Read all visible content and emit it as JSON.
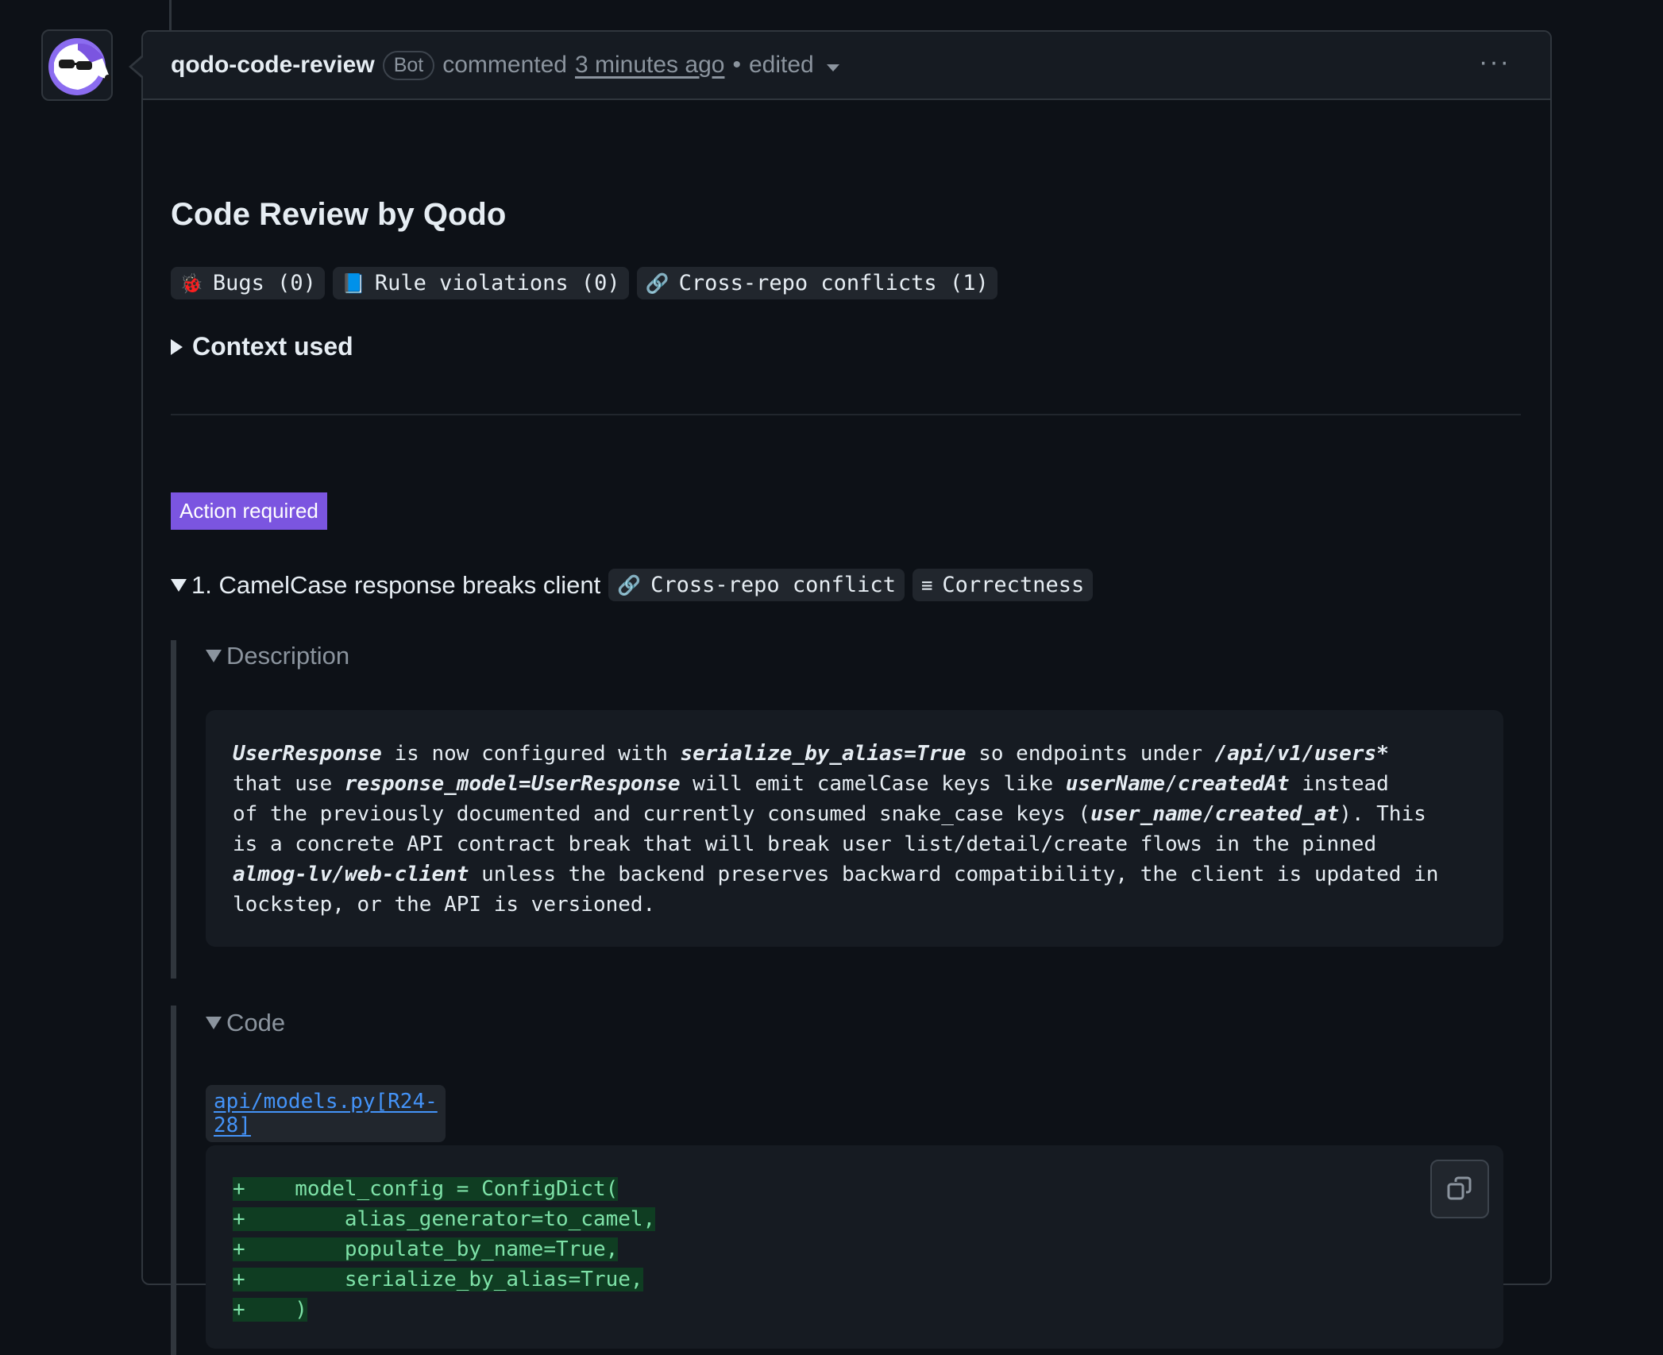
{
  "comment": {
    "author": "qodo-code-review",
    "badge": "Bot",
    "action": "commented",
    "time": "3 minutes ago",
    "separator": "•",
    "edited": "edited",
    "menu": "···"
  },
  "review": {
    "title": "Code Review by Qodo",
    "chips": [
      {
        "icon": "ladybug-icon",
        "glyph": "🐞",
        "label": "Bugs (0)"
      },
      {
        "icon": "book-icon",
        "glyph": "📘",
        "label": "Rule violations (0)"
      },
      {
        "icon": "link-icon",
        "glyph": "🔗",
        "label": "Cross-repo conflicts (1)"
      }
    ],
    "context_label": "Context used",
    "action_badge": "Action required",
    "issue": {
      "title": "1. CamelCase response breaks client",
      "tags": [
        {
          "icon": "link-icon",
          "glyph": "🔗",
          "label": "Cross-repo conflict"
        },
        {
          "icon": "list-icon",
          "glyph": "≡",
          "label": "Correctness"
        }
      ],
      "description_heading": "Description",
      "description": {
        "p1": "UserResponse",
        "p2": " is now configured with ",
        "p3": "serialize_by_alias=True",
        "p4": " so endpoints under ",
        "p5": "/api/v1/users*",
        "p6": "that use ",
        "p7": "response_model=UserResponse",
        "p8": " will emit camelCase keys like ",
        "p9": "userName",
        "p10": "/",
        "p11": "createdAt",
        "p12": " instead",
        "p13": "of the previously documented and currently consumed snake_case keys (",
        "p14": "user_name",
        "p15": "/",
        "p16": "created_at",
        "p17": "). This",
        "p18": "is a concrete API contract break that will break user list/detail/create flows in the pinned",
        "p19": "almog-lv/web-client",
        "p20": " unless the backend preserves backward compatibility, the client is updated in",
        "p21": "lockstep, or the API is versioned."
      },
      "code_heading": "Code",
      "file_link": "api/models.py[R24-28]",
      "code_lines": [
        "+    model_config = ConfigDict(",
        "+        alias_generator=to_camel,",
        "+        populate_by_name=True,",
        "+        serialize_by_alias=True,",
        "+    )"
      ],
      "copy_icon": "copy-icon"
    }
  }
}
